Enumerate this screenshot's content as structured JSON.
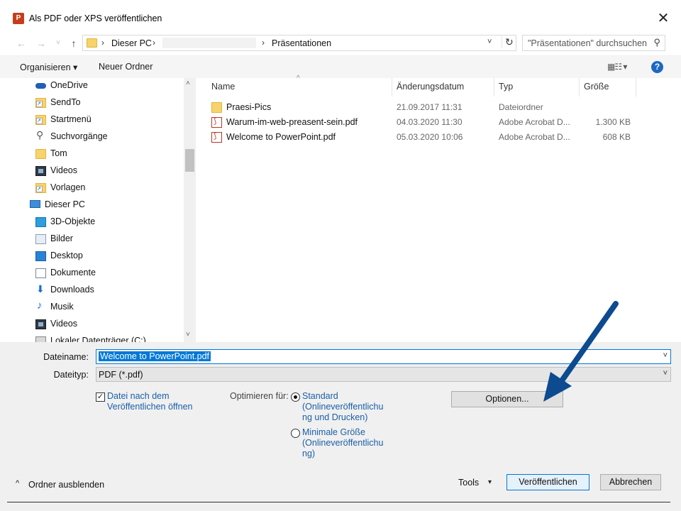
{
  "window": {
    "title": "Als PDF oder XPS veröffentlichen",
    "app_icon_letter": "P",
    "close_glyph": "✕"
  },
  "nav_buttons": {
    "back": "←",
    "forward": "→",
    "recent": "˅",
    "up": "↑"
  },
  "address": {
    "crumbs": [
      "Dieser PC",
      "Präsentationen"
    ],
    "separator": "›",
    "dropdown_glyph": "˅",
    "refresh_glyph": "↻"
  },
  "search": {
    "placeholder": "\"Präsentationen\" durchsuchen",
    "icon": "search-icon"
  },
  "toolbar": {
    "organize_label": "Organisieren ▾",
    "new_folder_label": "Neuer Ordner",
    "view_glyph": "▦☷ ▾",
    "help_glyph": "?"
  },
  "nav_pane": {
    "items": [
      {
        "label": "OneDrive",
        "icon": "onedrive-icon"
      },
      {
        "label": "SendTo",
        "icon": "shortcut-folder-icon"
      },
      {
        "label": "Startmenü",
        "icon": "shortcut-folder-icon"
      },
      {
        "label": "Suchvorgänge",
        "icon": "search-icon"
      },
      {
        "label": "Tom",
        "icon": "folder-icon"
      },
      {
        "label": "Videos",
        "icon": "video-icon"
      },
      {
        "label": "Vorlagen",
        "icon": "shortcut-folder-icon"
      },
      {
        "label": "Dieser PC",
        "icon": "computer-icon"
      },
      {
        "label": "3D-Objekte",
        "icon": "3d-objects-icon"
      },
      {
        "label": "Bilder",
        "icon": "pictures-icon"
      },
      {
        "label": "Desktop",
        "icon": "desktop-icon"
      },
      {
        "label": "Dokumente",
        "icon": "documents-icon"
      },
      {
        "label": "Downloads",
        "icon": "download-icon"
      },
      {
        "label": "Musik",
        "icon": "music-icon"
      },
      {
        "label": "Videos",
        "icon": "video-icon"
      },
      {
        "label": "Lokaler Datenträger (C:)",
        "icon": "drive-icon"
      }
    ],
    "scroll_up": "˄",
    "scroll_down": "˅"
  },
  "columns": {
    "name": "Name",
    "date": "Änderungsdatum",
    "type": "Typ",
    "size": "Größe",
    "sort_glyph": "^"
  },
  "files": [
    {
      "name": "Praesi-Pics",
      "date": "21.09.2017 11:31",
      "type": "Dateiordner",
      "size": "",
      "icon": "folder-icon"
    },
    {
      "name": "Warum-im-web-preasent-sein.pdf",
      "date": "04.03.2020 11:30",
      "type": "Adobe Acrobat D...",
      "size": "1.300 KB",
      "icon": "pdf-icon"
    },
    {
      "name": "Welcome to PowerPoint.pdf",
      "date": "05.03.2020 10:06",
      "type": "Adobe Acrobat D...",
      "size": "608 KB",
      "icon": "pdf-icon"
    }
  ],
  "save_form": {
    "filename_label": "Dateiname:",
    "filename_value": "Welcome to PowerPoint.pdf",
    "filetype_label": "Dateityp:",
    "filetype_value": "PDF (*.pdf)",
    "dropdown_glyph": "˅",
    "open_after_checked": true,
    "open_after_label_line1": "Datei nach dem",
    "open_after_label_line2": "Veröffentlichen öffnen",
    "check_glyph": "✓",
    "optimize_label": "Optimieren für:",
    "optimize_options": [
      {
        "lines": [
          "Standard",
          "(Onlineveröffentlichu",
          "ng und Drucken)"
        ],
        "selected": true
      },
      {
        "lines": [
          "Minimale Größe",
          "(Onlineveröffentlichu",
          "ng)"
        ],
        "selected": false
      }
    ],
    "options_button": "Optionen..."
  },
  "footer": {
    "hide_folders_label": "Ordner ausblenden",
    "hide_caret": "^",
    "tools_label": "Tools",
    "tools_caret": "▾",
    "publish_button": "Veröffentlichen",
    "cancel_button": "Abbrechen"
  },
  "annotation": {
    "arrow_color": "#0d4a8f"
  }
}
